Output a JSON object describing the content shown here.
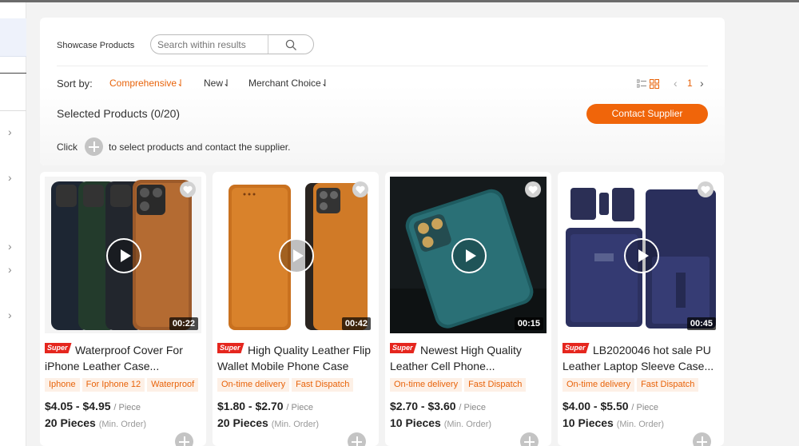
{
  "showcase": {
    "label": "Showcase Products",
    "search_placeholder": "Search within results"
  },
  "sort": {
    "label": "Sort by:",
    "options": [
      {
        "label": "Comprehensive⇃",
        "active": true
      },
      {
        "label": "New⇃",
        "active": false
      },
      {
        "label": "Merchant Choice⇃",
        "active": false
      }
    ]
  },
  "pager": {
    "prev": "‹",
    "page": "1",
    "next": "›"
  },
  "selection": {
    "label": "Selected Products (0/20)",
    "contact_button": "Contact Supplier",
    "hint_prefix": "Click",
    "hint_suffix": "to select products and contact the supplier."
  },
  "accent_color": "#f0650a",
  "products": [
    {
      "badge": "Super",
      "title": "Waterproof Cover For iPhone Leather Case...",
      "tags": [
        "Iphone",
        "For Iphone 12",
        "Waterproof"
      ],
      "price": "$4.05 - $4.95",
      "price_unit": "/ Piece",
      "moq": "20 Pieces",
      "moq_note": "(Min. Order)",
      "duration": "00:22"
    },
    {
      "badge": "Super",
      "title": "High Quality Leather Flip Wallet Mobile Phone Case For...",
      "tags": [
        "On-time delivery",
        "Fast Dispatch"
      ],
      "price": "$1.80 - $2.70",
      "price_unit": "/ Piece",
      "moq": "20 Pieces",
      "moq_note": "(Min. Order)",
      "duration": "00:42"
    },
    {
      "badge": "Super",
      "title": "Newest High Quality Leather Cell Phone...",
      "tags": [
        "On-time delivery",
        "Fast Dispatch"
      ],
      "price": "$2.70 - $3.60",
      "price_unit": "/ Piece",
      "moq": "10 Pieces",
      "moq_note": "(Min. Order)",
      "duration": "00:15"
    },
    {
      "badge": "Super",
      "title": "LB2020046 hot sale PU Leather Laptop Sleeve Case...",
      "tags": [
        "On-time delivery",
        "Fast Dispatch"
      ],
      "price": "$4.00 - $5.50",
      "price_unit": "/ Piece",
      "moq": "10 Pieces",
      "moq_note": "(Min. Order)",
      "duration": "00:45"
    }
  ]
}
